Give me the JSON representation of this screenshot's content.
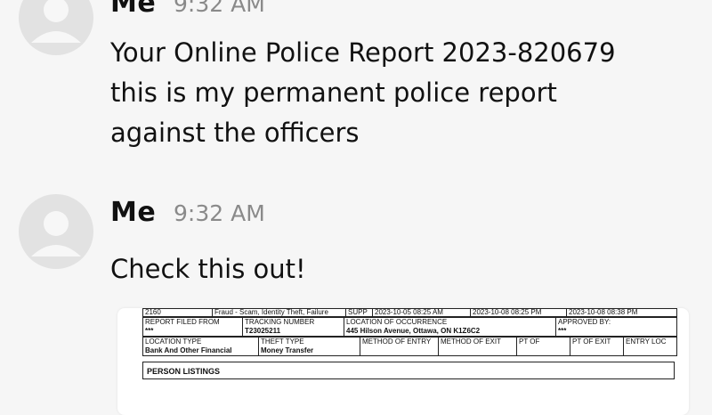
{
  "messages": [
    {
      "sender": "Me",
      "time": "9:32 AM",
      "text": "Your Online Police Report 2023-820679\nthis is my permanent police report\nagainst the officers"
    },
    {
      "sender": "Me",
      "time": "9:32 AM",
      "text": "Check this out!"
    }
  ],
  "attachment": {
    "top_row": [
      "2160",
      "Fraud - Scam, Identity Theft, Failure",
      "SUPP",
      "2023-10-05 08:25 AM",
      "2023-10-08 08:25 PM",
      "2023-10-08 08:38 PM"
    ],
    "row1": {
      "report_filed_from_label": "REPORT FILED FROM",
      "report_filed_from_value": "***",
      "tracking_number_label": "TRACKING NUMBER",
      "tracking_number_value": "T23025211",
      "location_label": "LOCATION OF OCCURRENCE",
      "location_value": "445 Hilson Avenue, Ottawa, ON K1Z6C2",
      "approved_by_label": "APPROVED BY:",
      "approved_by_value": "***"
    },
    "row2": {
      "location_type_label": "LOCATION TYPE",
      "location_type_value": "Bank And Other Financial",
      "theft_type_label": "THEFT TYPE",
      "theft_type_value": "Money Transfer",
      "method_entry_label": "METHOD OF ENTRY",
      "method_exit_label": "METHOD OF EXIT",
      "pt_of_label": "PT OF",
      "pt_of_exit_label": "PT OF EXIT",
      "entry_loc_label": "ENTRY LOC"
    },
    "person_listings": "PERSON LISTINGS"
  }
}
